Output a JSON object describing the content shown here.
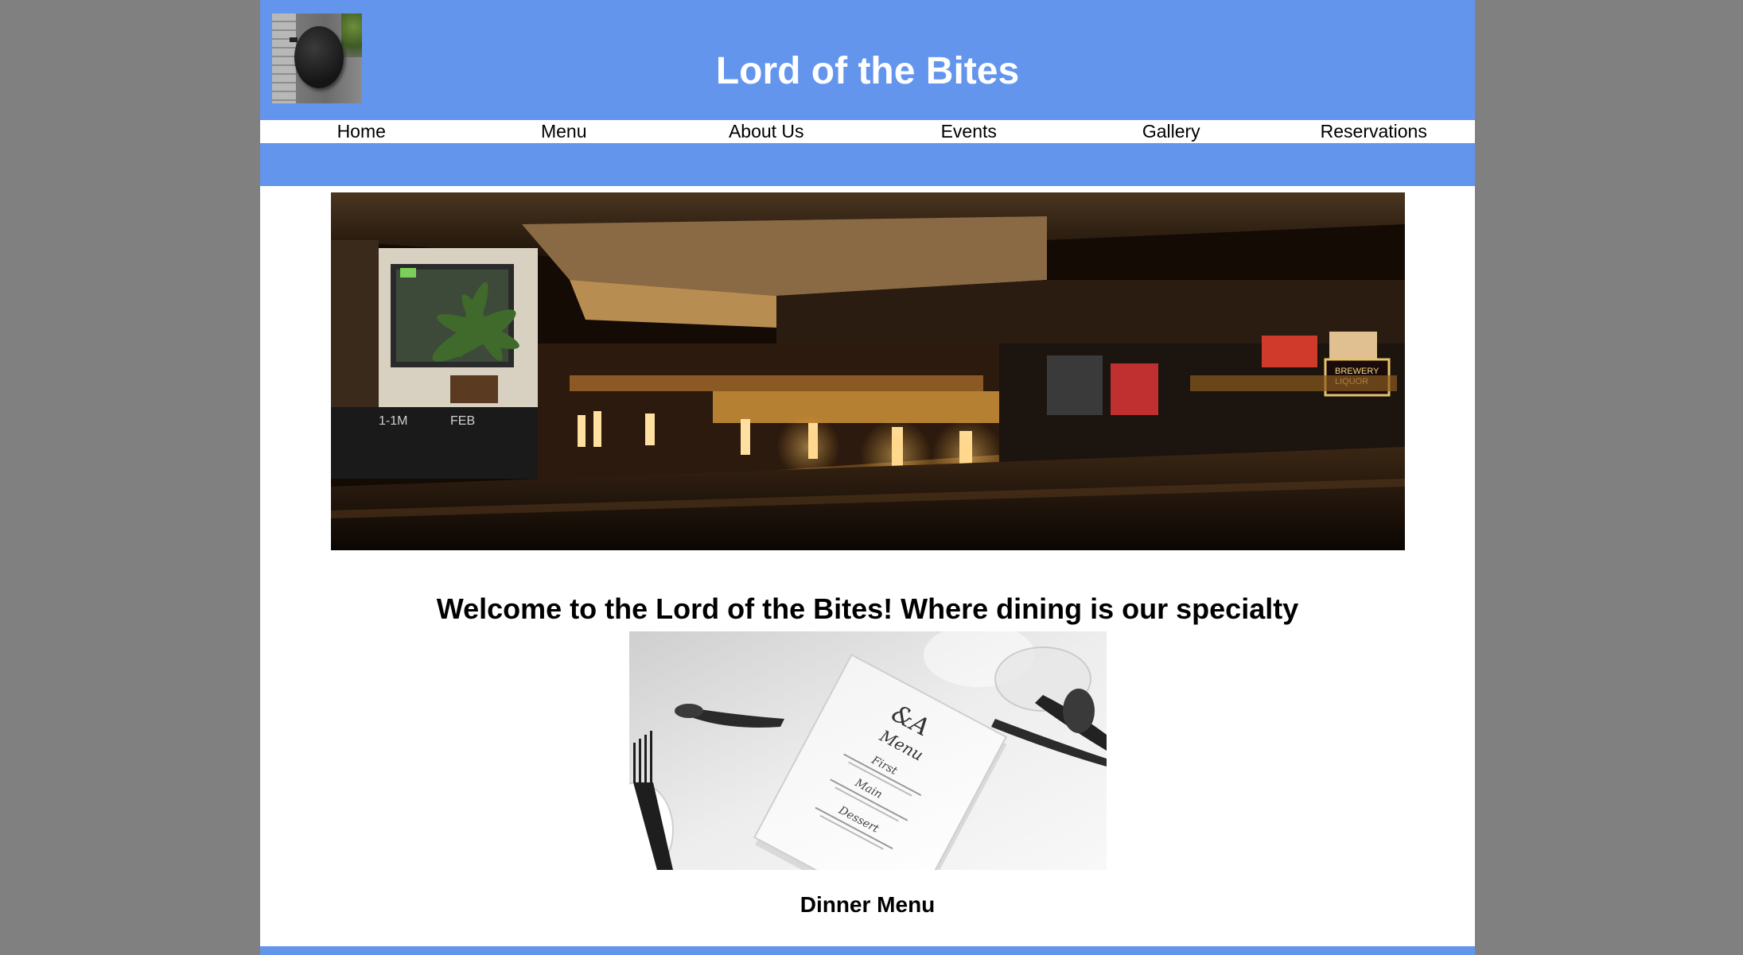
{
  "header": {
    "title": "Lord of the Bites",
    "logo_icon": "restaurant-sign-logo",
    "background_color": "#6495ED"
  },
  "nav": {
    "items": [
      {
        "label": "Home"
      },
      {
        "label": "Menu"
      },
      {
        "label": "About Us"
      },
      {
        "label": "Events"
      },
      {
        "label": "Gallery"
      },
      {
        "label": "Reservations"
      }
    ]
  },
  "main": {
    "hero_image": "restaurant-interior-photo",
    "welcome": "Welcome to the Lord of the Bites! Where dining is our specialty",
    "menu_image": "dinner-menu-table-setting-photo",
    "menu_caption": "Dinner Menu"
  },
  "page": {
    "outer_background": "#808080",
    "content_background": "#ffffff"
  }
}
